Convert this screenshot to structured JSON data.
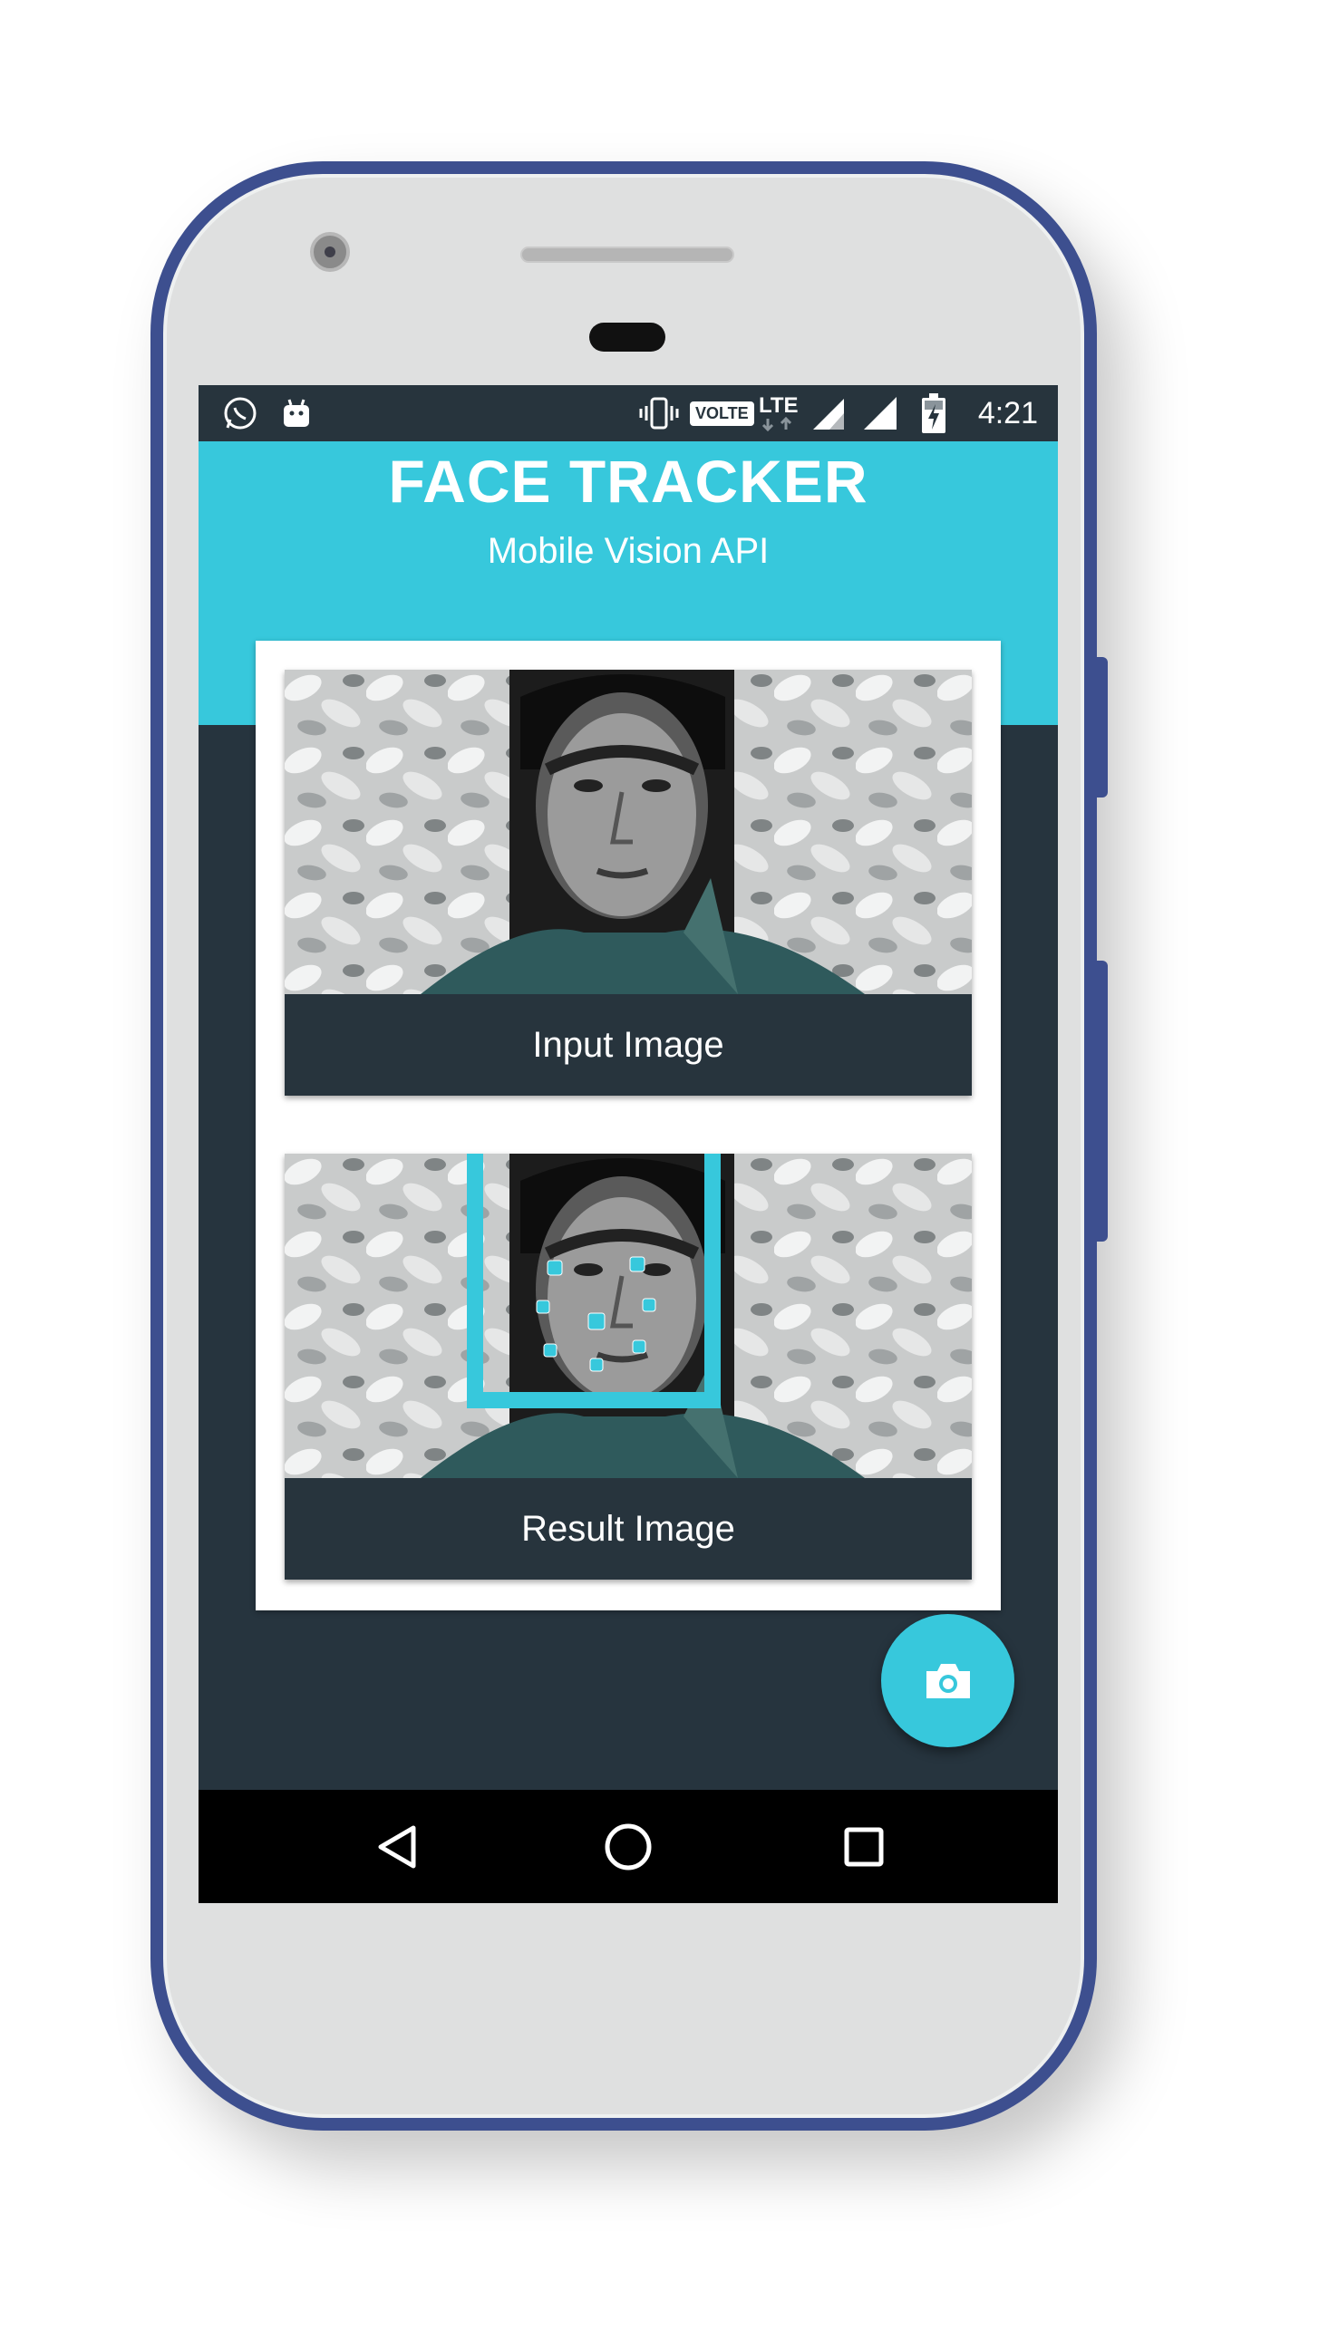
{
  "status_bar": {
    "time": "4:21",
    "network_badge": "VOLTE",
    "lte_label": "LTE",
    "icons": [
      "whatsapp-icon",
      "android-icon",
      "vibrate-icon",
      "volte-icon",
      "lte-icon",
      "signal-icon",
      "signal-icon",
      "battery-charging-icon"
    ]
  },
  "app": {
    "title": "FACE TRACKER",
    "subtitle": "Mobile Vision API"
  },
  "panels": {
    "input_label": "Input Image",
    "result_label": "Result Image"
  },
  "fab": {
    "icon": "camera-icon"
  },
  "nav": {
    "icons": [
      "back-icon",
      "home-icon",
      "recents-icon"
    ]
  },
  "colors": {
    "accent": "#37c8dc",
    "dark": "#26343e",
    "frame": "#3d4f8f"
  }
}
